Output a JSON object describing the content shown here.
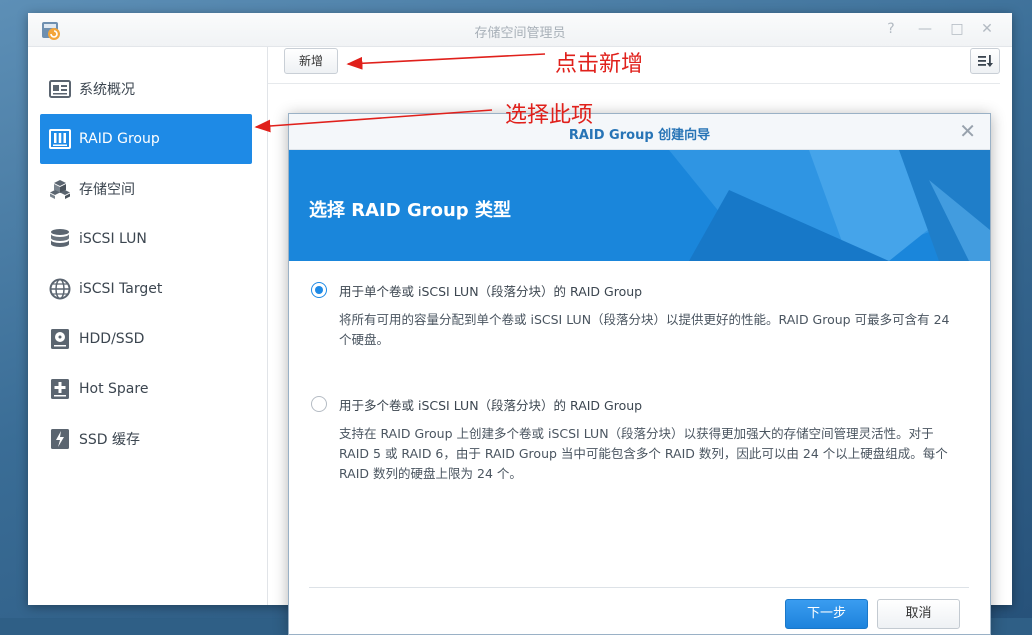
{
  "window": {
    "title": "存储空间管理员",
    "controls": {
      "help": "?",
      "minimize": "—",
      "maximize": "□",
      "close": "✕"
    }
  },
  "sidebar": {
    "items": [
      {
        "label": "系统概况",
        "icon": "overview-icon",
        "active": false
      },
      {
        "label": "RAID Group",
        "icon": "raid-group-icon",
        "active": true
      },
      {
        "label": "存储空间",
        "icon": "storage-space-icon",
        "active": false
      },
      {
        "label": "iSCSI LUN",
        "icon": "iscsi-lun-icon",
        "active": false
      },
      {
        "label": "iSCSI Target",
        "icon": "iscsi-target-icon",
        "active": false
      },
      {
        "label": "HDD/SSD",
        "icon": "hdd-ssd-icon",
        "active": false
      },
      {
        "label": "Hot Spare",
        "icon": "hot-spare-icon",
        "active": false
      },
      {
        "label": "SSD 缓存",
        "icon": "ssd-cache-icon",
        "active": false
      }
    ]
  },
  "toolbar": {
    "create_label": "新增"
  },
  "dialog": {
    "title": "RAID Group 创建向导",
    "close": "✕",
    "banner_title": "选择 RAID Group 类型",
    "options": [
      {
        "label": "用于单个卷或 iSCSI LUN（段落分块）的 RAID Group",
        "desc": "将所有可用的容量分配到单个卷或 iSCSI LUN（段落分块）以提供更好的性能。RAID Group 可最多可含有 24 个硬盘。",
        "checked": true
      },
      {
        "label": "用于多个卷或 iSCSI LUN（段落分块）的 RAID Group",
        "desc": "支持在 RAID Group 上创建多个卷或 iSCSI LUN（段落分块）以获得更加强大的存储空间管理灵活性。对于RAID 5 或 RAID 6，由于 RAID Group 当中可能包含多个 RAID 数列，因此可以由 24 个以上硬盘组成。每个 RAID 数列的硬盘上限为 24 个。",
        "checked": false
      }
    ],
    "next_label": "下一步",
    "cancel_label": "取消"
  },
  "annotations": {
    "click_create": "点击新增",
    "select_this": "选择此项",
    "color": "#e0201b"
  },
  "colors": {
    "accent": "#1e8ae6",
    "banner": "#1a86db"
  }
}
